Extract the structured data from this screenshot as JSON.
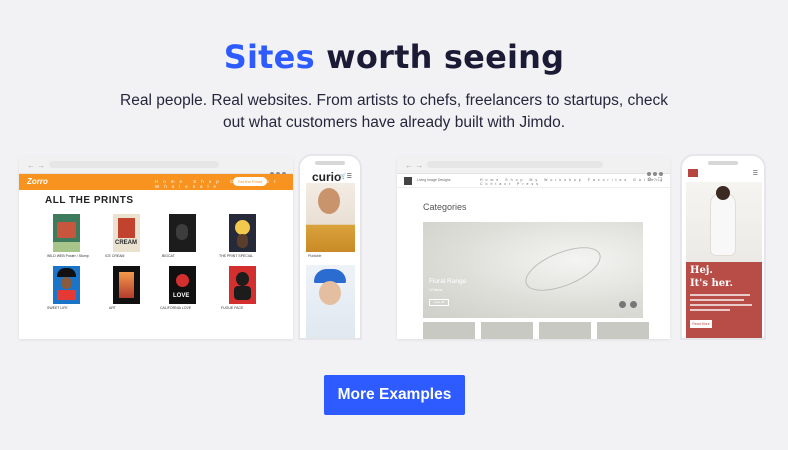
{
  "header": {
    "title_accent": "Sites",
    "title_rest": "worth seeing",
    "subtitle_line1": "Real people. Real websites. From artists to chefs, freelancers to startups, check",
    "subtitle_line2": "out what customers have already built with Jimdo."
  },
  "colors": {
    "accent": "#2e5bff",
    "background": "#f2f2f4",
    "site1_brand": "#f7931e",
    "site4_brand": "#b84c47"
  },
  "examples": {
    "site1": {
      "logo": "Zorro",
      "menu": "Home  Shop  Contact  Wholesale",
      "button": "Get the Prints",
      "heading": "ALL THE PRINTS",
      "posters": [
        {
          "caption": "WILD WEB Poster / Stump",
          "color": "#3e7a5c"
        },
        {
          "caption": "ICE CREAM",
          "color": "#c1422d"
        },
        {
          "caption": "BIGCAT",
          "color": "#1c1c1c"
        },
        {
          "caption": "THE PRINT SPECIAL",
          "color": "#262a38"
        },
        {
          "caption": "SWEET LIFE",
          "color": "#1a74c7"
        },
        {
          "caption": "ART",
          "color": "#101010"
        },
        {
          "caption": "CALIFORNIA LOVE",
          "color": "#101010"
        },
        {
          "caption": "FUGUE FACE",
          "color": "#d32f2f"
        }
      ],
      "poster_words": {
        "cream": "CREAM",
        "love": "LOVE"
      }
    },
    "site2": {
      "logo": "curio",
      "caption": "Plaitable"
    },
    "site3": {
      "brand": "Living Image Designs",
      "menu": "Home  Shop  My Workshop  Favorites  Gallery  Contact  Press",
      "heading": "Categories",
      "hero_title": "Floral Range",
      "hero_sub": "12 items",
      "hero_button": "view all"
    },
    "site4": {
      "logo": "hej",
      "headline1": "Hej.",
      "headline2": "It's her.",
      "button": "Read More"
    }
  },
  "icons": {
    "browser_nav": "arrow-icon",
    "browser_menu": "more-dots-icon",
    "phone_menu": "hamburger-icon",
    "cart": "cart-icon"
  },
  "cta": {
    "label": "More Examples"
  }
}
